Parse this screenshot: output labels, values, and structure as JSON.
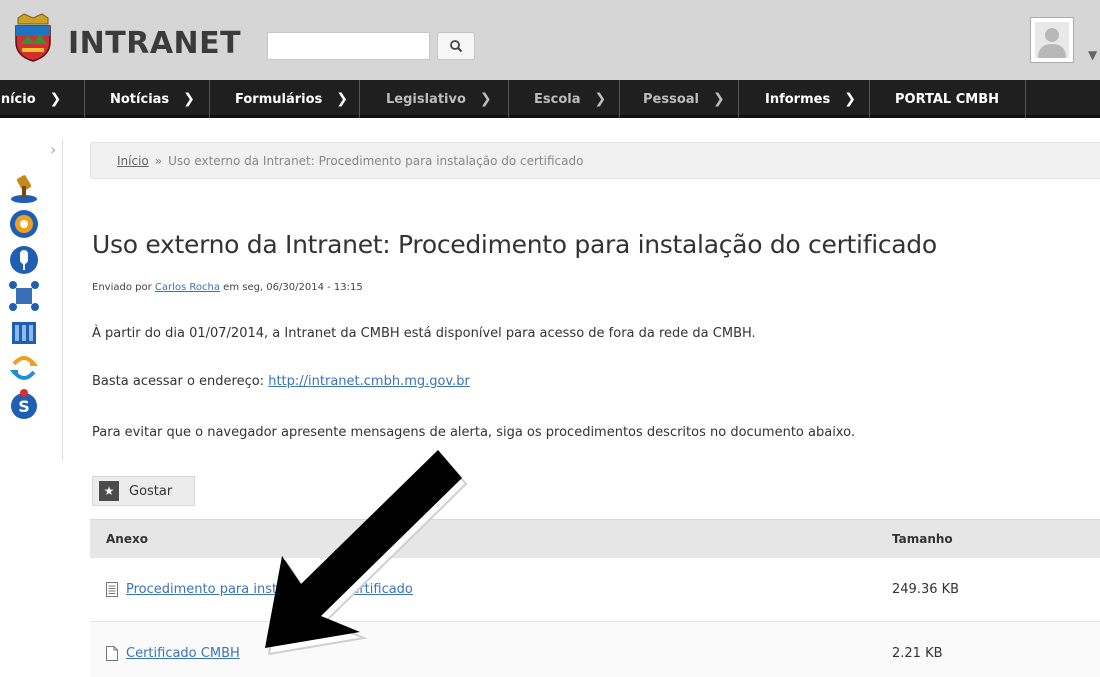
{
  "header": {
    "brand": "INTRANET",
    "search": {
      "value": "",
      "placeholder": ""
    },
    "search_icon": "search-icon",
    "avatar_icon": "user-avatar-icon"
  },
  "nav": {
    "items": [
      {
        "label": "Início",
        "dim": false
      },
      {
        "label": "Notícias",
        "dim": false
      },
      {
        "label": "Formulários",
        "dim": false
      },
      {
        "label": "Legislativo",
        "dim": true
      },
      {
        "label": "Escola",
        "dim": true
      },
      {
        "label": "Pessoal",
        "dim": true
      },
      {
        "label": "Informes",
        "dim": false
      },
      {
        "label": "PORTAL CMBH",
        "dim": false
      }
    ]
  },
  "breadcrumb": {
    "home": "Início",
    "separator": "»",
    "current": "Uso externo da Intranet: Procedimento para instalação do certificado"
  },
  "article": {
    "title": "Uso externo da Intranet: Procedimento para instalação do certificado",
    "submitted_prefix": "Enviado por",
    "author": "Carlos Rocha",
    "submitted_suffix": "em seg, 06/30/2014 - 13:15",
    "para1": "À partir do dia 01/07/2014, a Intranet da CMBH está disponível para acesso de fora da rede da CMBH.",
    "para2_prefix": "Basta acessar o endereço:",
    "para2_link": "http://intranet.cmbh.mg.gov.br",
    "para3": "Para evitar que o navegador apresente mensagens de alerta, siga os procedimentos descritos no documento abaixo."
  },
  "like": {
    "label": "Gostar",
    "icon": "star-icon"
  },
  "attachments": {
    "headers": {
      "name": "Anexo",
      "size": "Tamanho"
    },
    "rows": [
      {
        "name": "Procedimento para instalação do certificado",
        "size": "249.36 KB",
        "icon": "document-icon"
      },
      {
        "name": "Certificado CMBH",
        "size": "2.21 KB",
        "icon": "file-icon"
      }
    ]
  },
  "colors": {
    "nav_bg": "#1f1f1f",
    "header_bg": "#d6d6d6",
    "link": "#3b73b9"
  }
}
